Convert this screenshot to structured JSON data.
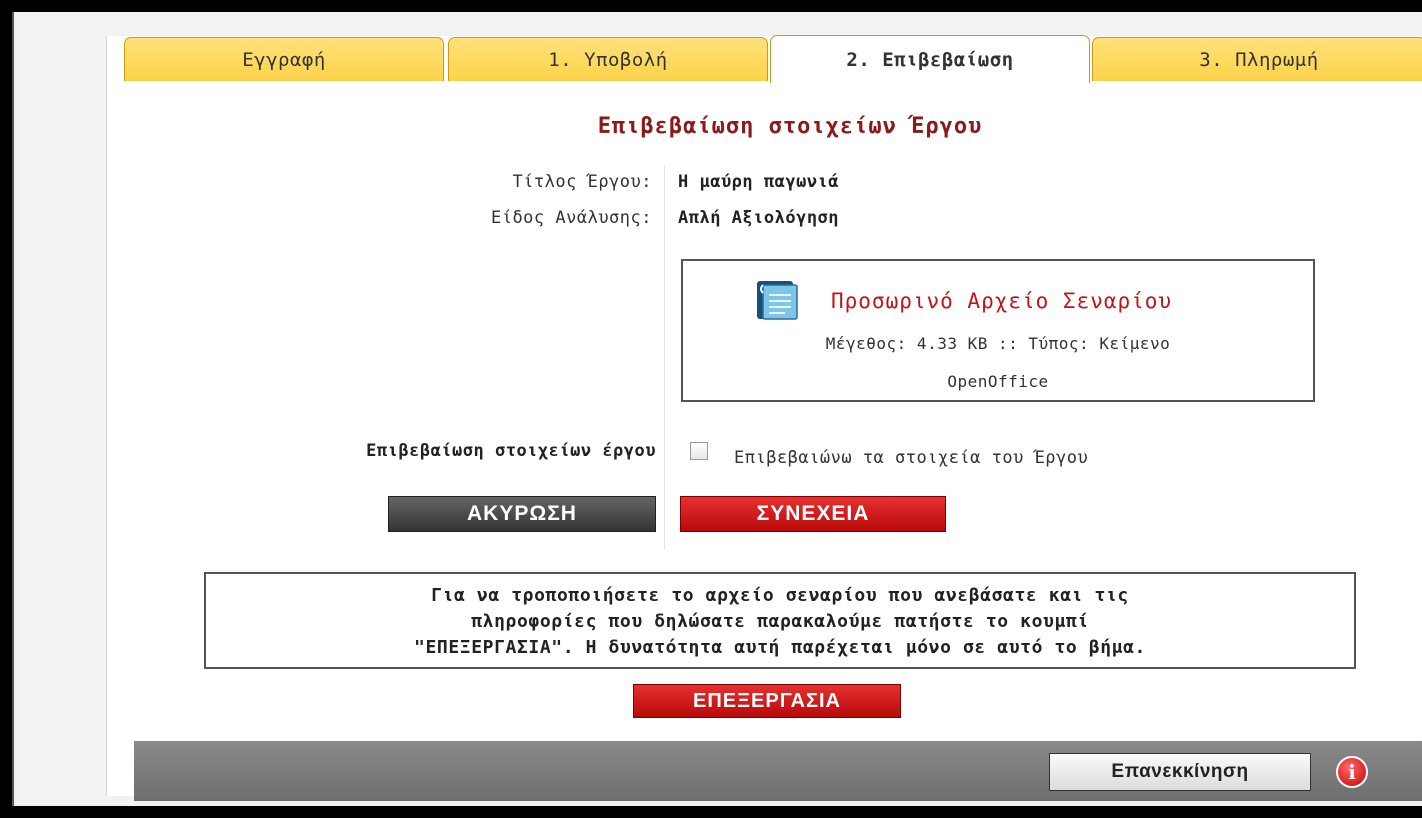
{
  "tabs": [
    {
      "label": "Εγγραφή"
    },
    {
      "label": "1. Υποβολή"
    },
    {
      "label": "2. Επιβεβαίωση",
      "active": true
    },
    {
      "label": "3. Πληρωμή"
    }
  ],
  "section_title": "Επιβεβαίωση στοιχείων Έργου",
  "details": {
    "title_label": "Τίτλος Έργου:",
    "title_value": "Η μαύρη παγωνιά",
    "analysis_label": "Είδος Ανάλυσης:",
    "analysis_value": "Απλή Αξιολόγηση"
  },
  "file": {
    "icon": "document-icon",
    "name": "Προσωρινό Αρχείο Σεναρίου",
    "meta_line1": "Μέγεθος: 4.33 KB :: Τύπος: Κείμενο",
    "meta_line2": "OpenOffice"
  },
  "confirm": {
    "label": "Επιβεβαίωση στοιχείων έργου",
    "checkbox_label": "Επιβεβαιώνω τα στοιχεία του Έργου",
    "checked": false
  },
  "buttons": {
    "cancel": "ΑΚΥΡΩΣΗ",
    "next": "ΣΥΝΕΧΕΙΑ",
    "edit": "ΕΠΕΞΕΡΓΑΣΙΑ",
    "restart": "Επανεκκίνηση"
  },
  "note": {
    "line1": "Για να τροποποιήσετε το αρχείο σεναρίου που ανεβάσατε και τις",
    "line2": "πληροφορίες που δηλώσατε παρακαλούμε πατήστε το κουμπί",
    "line3": "\"ΕΠΕΞΕΡΓΑΣΙΑ\". Η δυνατότητα αυτή παρέχεται μόνο σε αυτό το βήμα."
  },
  "colors": {
    "accent_red": "#c0141a",
    "tab_yellow": "#fcd24a",
    "title_dark_red": "#8b1a1a"
  }
}
